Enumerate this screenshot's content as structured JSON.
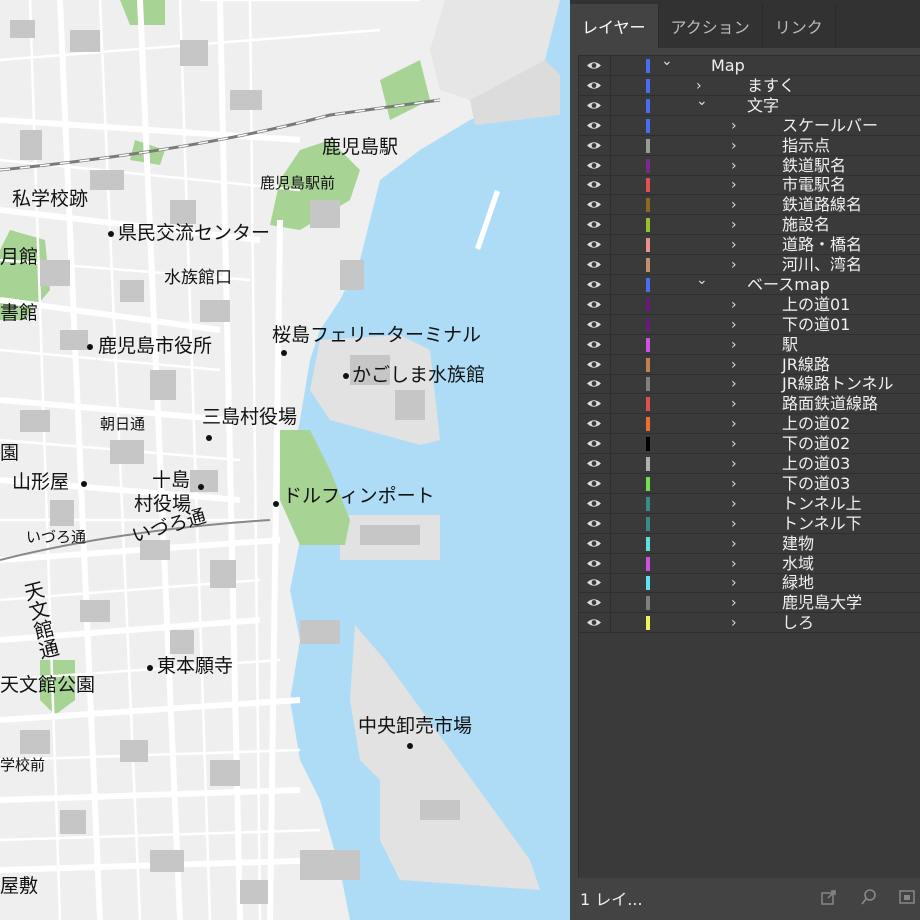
{
  "panel": {
    "tabs": [
      {
        "label": "レイヤー",
        "active": true
      },
      {
        "label": "アクション",
        "active": false
      },
      {
        "label": "リンク",
        "active": false
      }
    ],
    "layers": [
      {
        "name": "Map",
        "level": 0,
        "expanded": true,
        "color": "#4a6cf0"
      },
      {
        "name": "ますく",
        "level": 1,
        "expanded": false,
        "color": "#4a6cf0"
      },
      {
        "name": "文字",
        "level": 1,
        "expanded": true,
        "color": "#4a6cf0"
      },
      {
        "name": "スケールバー",
        "level": 2,
        "expanded": false,
        "color": "#4a6cf0"
      },
      {
        "name": "指示点",
        "level": 2,
        "expanded": false,
        "color": "#9a9a9a"
      },
      {
        "name": "鉄道駅名",
        "level": 2,
        "expanded": false,
        "color": "#7a2a8a"
      },
      {
        "name": "市電駅名",
        "level": 2,
        "expanded": false,
        "color": "#e05050"
      },
      {
        "name": "鉄道路線名",
        "level": 2,
        "expanded": false,
        "color": "#8a6a20"
      },
      {
        "name": "施設名",
        "level": 2,
        "expanded": false,
        "color": "#9ac030"
      },
      {
        "name": "道路・橋名",
        "level": 2,
        "expanded": false,
        "color": "#e89090"
      },
      {
        "name": "河川、湾名",
        "level": 2,
        "expanded": false,
        "color": "#c09070"
      },
      {
        "name": "ベースmap",
        "level": 1,
        "expanded": true,
        "color": "#4a6cf0"
      },
      {
        "name": "上の道01",
        "level": 2,
        "expanded": false,
        "color": "#6a1a7a"
      },
      {
        "name": "下の道01",
        "level": 2,
        "expanded": false,
        "color": "#6a1a7a"
      },
      {
        "name": "駅",
        "level": 2,
        "expanded": false,
        "color": "#d050e0"
      },
      {
        "name": "JR線路",
        "level": 2,
        "expanded": false,
        "color": "#c08050"
      },
      {
        "name": "JR線路トンネル",
        "level": 2,
        "expanded": false,
        "color": "#808080"
      },
      {
        "name": "路面鉄道線路",
        "level": 2,
        "expanded": false,
        "color": "#e05050"
      },
      {
        "name": "上の道02",
        "level": 2,
        "expanded": false,
        "color": "#f07030"
      },
      {
        "name": "下の道02",
        "level": 2,
        "expanded": false,
        "color": "#000000"
      },
      {
        "name": "上の道03",
        "level": 2,
        "expanded": false,
        "color": "#b0b0b0"
      },
      {
        "name": "下の道03",
        "level": 2,
        "expanded": false,
        "color": "#70e050"
      },
      {
        "name": "トンネル上",
        "level": 2,
        "expanded": false,
        "color": "#3a8a8a"
      },
      {
        "name": "トンネル下",
        "level": 2,
        "expanded": false,
        "color": "#3a8a8a"
      },
      {
        "name": "建物",
        "level": 2,
        "expanded": false,
        "color": "#60e0e0"
      },
      {
        "name": "水域",
        "level": 2,
        "expanded": false,
        "color": "#d050e0"
      },
      {
        "name": "緑地",
        "level": 2,
        "expanded": false,
        "color": "#60e0f0"
      },
      {
        "name": "鹿児島大学",
        "level": 2,
        "expanded": false,
        "color": "#808080"
      },
      {
        "name": "しろ",
        "level": 2,
        "expanded": false,
        "color": "#f0f060"
      }
    ],
    "footer": {
      "count": "1 レイ..."
    }
  },
  "map": {
    "labels": {
      "kagoshima_station": "鹿児島駅",
      "kagoshima_station_mae": "鹿児島駅前",
      "shigakkou": "私学校跡",
      "kenmin": "県民交流センター",
      "tsukikan": "月館",
      "suizokukan_guchi": "水族館口",
      "shokan": "書館",
      "ferry": "桜島フェリーターミナル",
      "shiyakusho": "鹿児島市役所",
      "suizokukan": "かごしま水族館",
      "asahi": "朝日通",
      "mishima": "三島村役場",
      "en": "園",
      "yamakataya": "山形屋",
      "toshima1": "十島",
      "toshima2": "村役場",
      "dolphin": "ドルフィンポート",
      "izuro_small": "いづろ通",
      "izuro_large": "いづろ通",
      "tenmonkan_dori": "天文館通",
      "higashi_honganji": "東本願寺",
      "tenmonkan_park": "天文館公園",
      "chuo_ichiba": "中央卸売市場",
      "gakkoumae": "学校前",
      "yashiki": "屋敷"
    }
  }
}
